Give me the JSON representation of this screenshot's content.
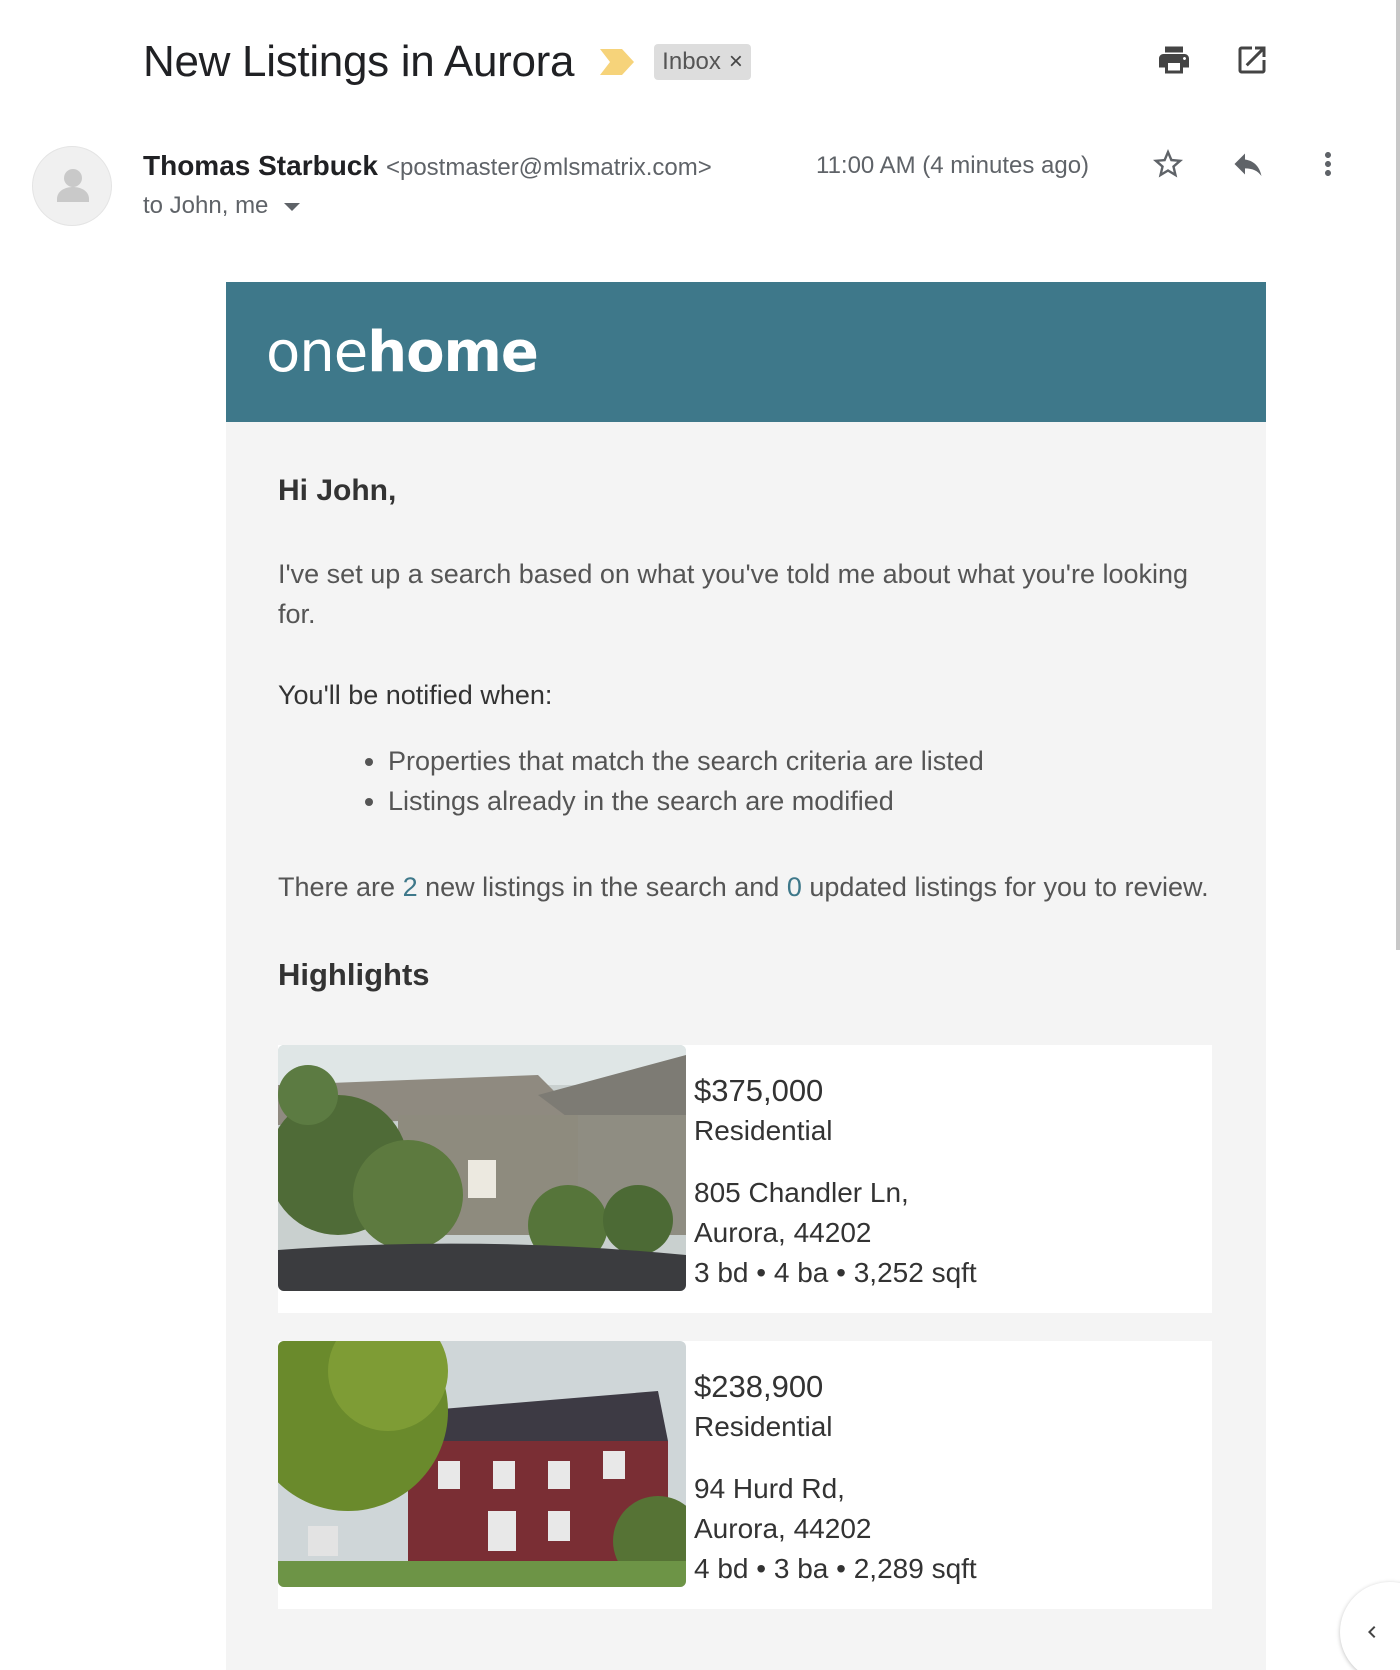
{
  "email": {
    "subject": "New Listings in Aurora",
    "label": "Inbox",
    "label_close": "×",
    "sender_name": "Thomas Starbuck",
    "sender_email": "<postmaster@mlsmatrix.com>",
    "recipients": "to John, me",
    "timestamp": "11:00 AM (4 minutes ago)"
  },
  "icons": {
    "importance": "importance-marker-icon",
    "print": "print-icon",
    "open_new_window": "open-in-new-window-icon",
    "star": "star-icon",
    "reply": "reply-icon",
    "more": "more-vertical-icon",
    "avatar": "person-icon",
    "collapse": "chevron-left-icon"
  },
  "colors": {
    "banner": "#3e788a",
    "importance": "#f6d37a",
    "link_number": "#3e788a"
  },
  "body": {
    "logo_one": "one",
    "logo_home": "home",
    "greeting": "Hi John,",
    "intro": "I've set up a search based on what you've told me about what you're looking for.",
    "notify_heading": "You'll be notified when:",
    "bullets": [
      "Properties that match the search criteria are listed",
      "Listings already in the search are modified"
    ],
    "summary_prefix": "There are ",
    "new_count": "2",
    "summary_middle": " new listings in the search and ",
    "updated_count": "0",
    "summary_suffix": " updated listings for you to review.",
    "highlights_title": "Highlights"
  },
  "listings": [
    {
      "price": "$375,000",
      "type": "Residential",
      "street": "805 Chandler Ln,",
      "city": "Aurora, 44202",
      "specs": "3 bd • 4 ba • 3,252 sqft"
    },
    {
      "price": "$238,900",
      "type": "Residential",
      "street": "94 Hurd Rd,",
      "city": "Aurora, 44202",
      "specs": "4 bd • 3 ba • 2,289 sqft"
    }
  ]
}
